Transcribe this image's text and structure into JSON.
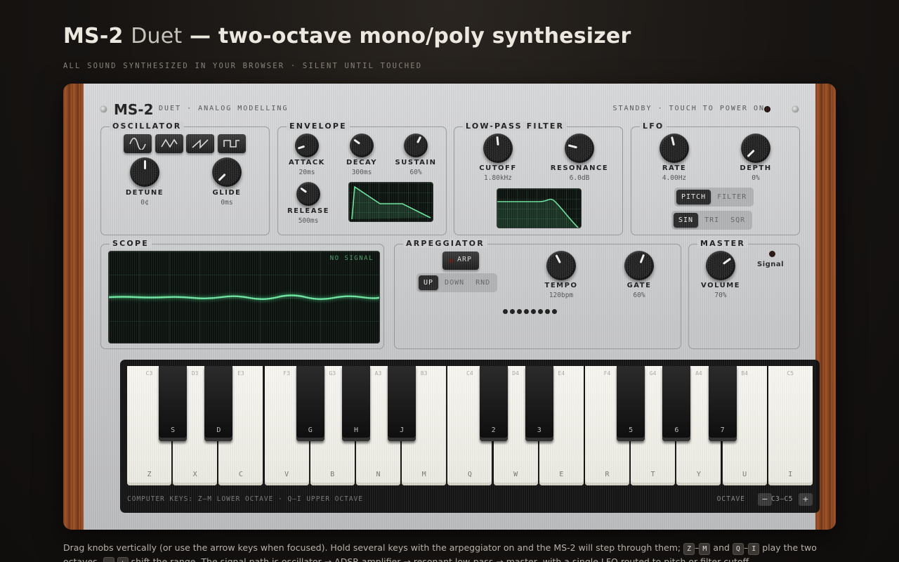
{
  "header": {
    "title_brand": "MS-2",
    "title_model": "Duet",
    "title_rest": "— two-octave mono/poly synthesizer",
    "subtitle": "ALL SOUND SYNTHESIZED IN YOUR BROWSER · SILENT UNTIL TOUCHED"
  },
  "panel": {
    "brand": "MS-2",
    "tag": "DUET · ANALOG MODELLING",
    "power_text": "STANDBY · TOUCH TO POWER ON"
  },
  "oscillator": {
    "label": "OSCILLATOR",
    "waves": [
      "sine-wave-icon",
      "triangle-wave-icon",
      "saw-wave-icon",
      "square-wave-icon"
    ],
    "detune": {
      "label": "DETUNE",
      "value": "0¢",
      "level": 0.5
    },
    "glide": {
      "label": "GLIDE",
      "value": "0ms",
      "level": 0.0
    }
  },
  "envelope": {
    "label": "ENVELOPE",
    "attack": {
      "label": "ATTACK",
      "value": "20ms",
      "level": 0.1
    },
    "decay": {
      "label": "DECAY",
      "value": "300ms",
      "level": 0.3
    },
    "sustain": {
      "label": "SUSTAIN",
      "value": "60%",
      "level": 0.6
    },
    "release": {
      "label": "RELEASE",
      "value": "500ms",
      "level": 0.3
    }
  },
  "filter": {
    "label": "LOW-PASS FILTER",
    "cutoff": {
      "label": "CUTOFF",
      "value": "1.80kHz",
      "level": 0.48
    },
    "resonance": {
      "label": "RESONANCE",
      "value": "6.0dB",
      "level": 0.22
    }
  },
  "lfo": {
    "label": "LFO",
    "rate": {
      "label": "RATE",
      "value": "4.00Hz",
      "level": 0.45
    },
    "depth": {
      "label": "DEPTH",
      "value": "0%",
      "level": 0.0
    },
    "target": [
      "PITCH",
      "FILTER"
    ],
    "target_selected": "PITCH",
    "shape": [
      "SIN",
      "TRI",
      "SQR"
    ],
    "shape_selected": "SIN"
  },
  "scope": {
    "label": "SCOPE",
    "status": "NO SIGNAL"
  },
  "arp": {
    "label": "ARPEGGIATOR",
    "toggle": "ARP",
    "modes": [
      "UP",
      "DOWN",
      "RND"
    ],
    "mode_selected": "UP",
    "tempo": {
      "label": "TEMPO",
      "value": "120bpm",
      "level": 0.4
    },
    "gate": {
      "label": "GATE",
      "value": "60%",
      "level": 0.58
    },
    "steps": 8
  },
  "master": {
    "label": "MASTER",
    "volume": {
      "label": "VOLUME",
      "value": "70%",
      "level": 0.7
    },
    "signal": "Signal"
  },
  "keyboard": {
    "white": [
      {
        "note": "C3",
        "key": "Z"
      },
      {
        "note": "D3",
        "key": "X"
      },
      {
        "note": "E3",
        "key": "C"
      },
      {
        "note": "F3",
        "key": "V"
      },
      {
        "note": "G3",
        "key": "B"
      },
      {
        "note": "A3",
        "key": "N"
      },
      {
        "note": "B3",
        "key": "M"
      },
      {
        "note": "C4",
        "key": "Q"
      },
      {
        "note": "D4",
        "key": "W"
      },
      {
        "note": "E4",
        "key": "E"
      },
      {
        "note": "F4",
        "key": "R"
      },
      {
        "note": "G4",
        "key": "T"
      },
      {
        "note": "A4",
        "key": "Y"
      },
      {
        "note": "B4",
        "key": "U"
      },
      {
        "note": "C5",
        "key": "I"
      }
    ],
    "black": [
      {
        "after": 0,
        "key": "S"
      },
      {
        "after": 1,
        "key": "D"
      },
      {
        "after": 3,
        "key": "G"
      },
      {
        "after": 4,
        "key": "H"
      },
      {
        "after": 5,
        "key": "J"
      },
      {
        "after": 7,
        "key": "2"
      },
      {
        "after": 8,
        "key": "3"
      },
      {
        "after": 10,
        "key": "5"
      },
      {
        "after": 11,
        "key": "6"
      },
      {
        "after": 12,
        "key": "7"
      }
    ],
    "hint": "COMPUTER KEYS: Z–M LOWER OCTAVE · Q–I UPPER OCTAVE",
    "octave_label": "OCTAVE",
    "octave_minus": "−",
    "octave_range": "C3–C5",
    "octave_plus": "+"
  },
  "footer": {
    "p1": "Drag knobs vertically (or use the arrow keys when focused). Hold several keys with the arpeggiator on and the MS-2 will step through them;",
    "k1": "Z",
    "dash1": "–",
    "k2": "M",
    "and": "and",
    "k3": "Q",
    "dash2": "–",
    "k4": "I",
    "p2": "play the two octaves,",
    "k5": "−",
    "k6": "+",
    "p3": "shift the range. The signal path is oscillator → ADSR amplifier → resonant low-pass → master, with a single LFO routed to pitch or filter cutoff."
  },
  "colors": {
    "scope_trace": "#6ee6a0",
    "panel": "#cfd0d2",
    "wood": "#8b4722"
  }
}
